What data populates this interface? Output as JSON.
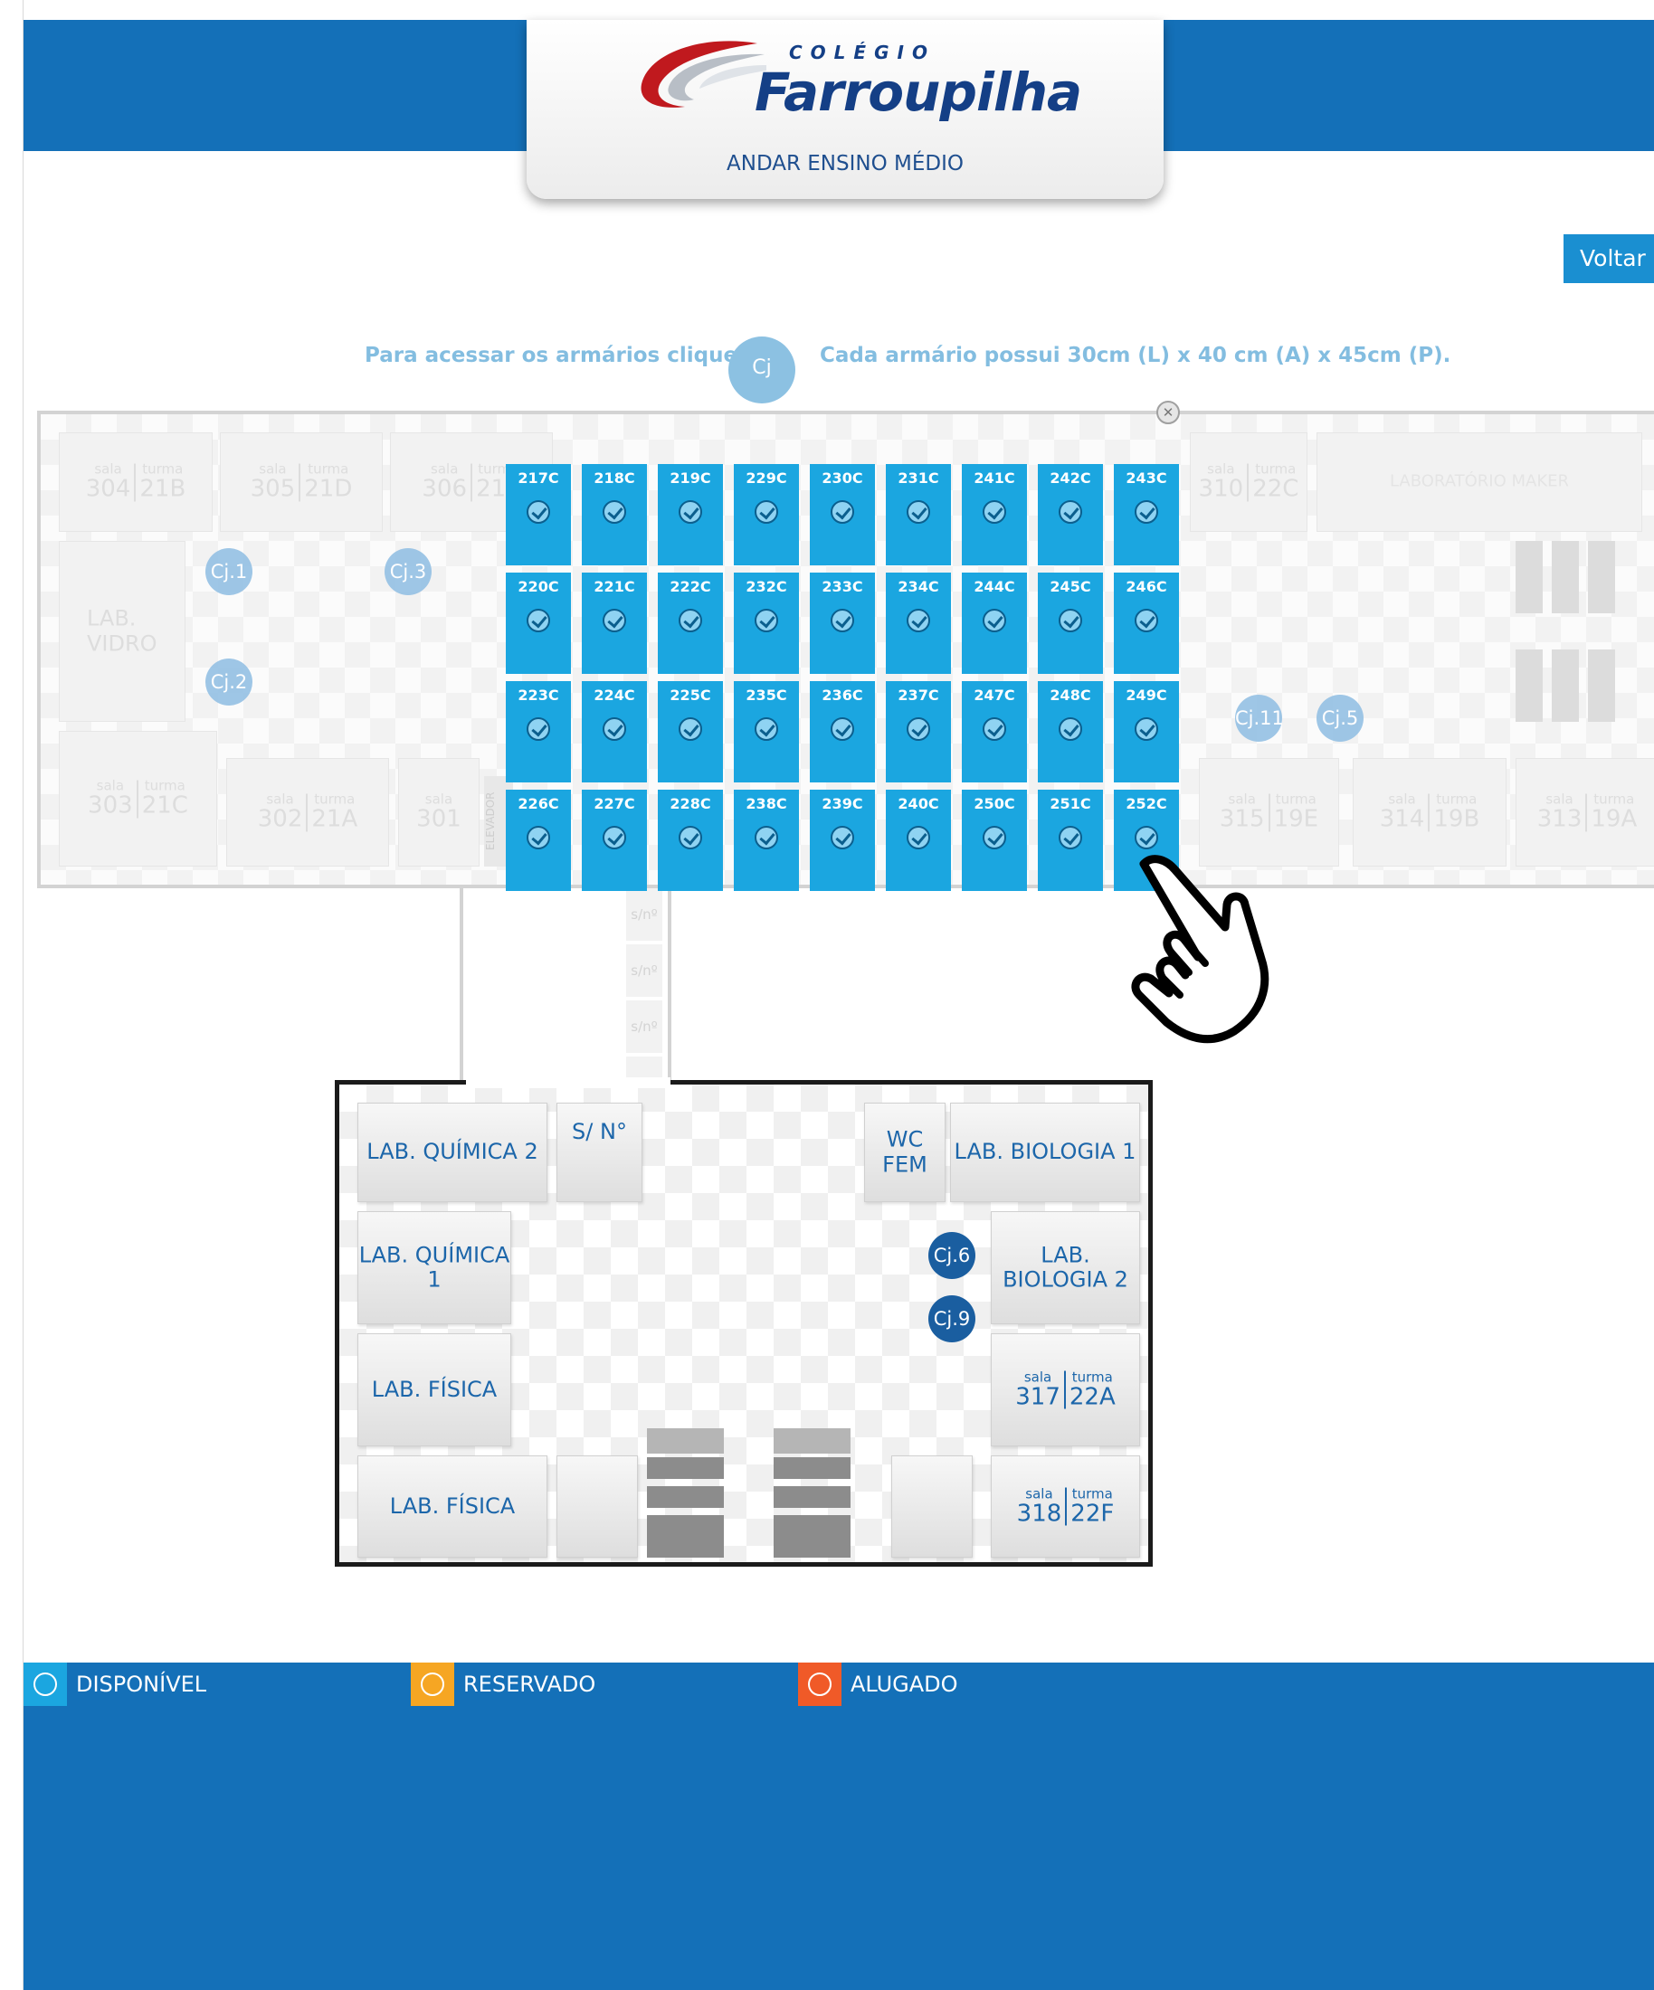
{
  "header": {
    "logo_small": "COLÉGIO",
    "logo_name": "Farroupilha",
    "floor_title": "ANDAR ENSINO MÉDIO",
    "back_label": "Voltar"
  },
  "instructions": {
    "left_text": "Para acessar os armários clique em",
    "badge": "Cj",
    "right_text": "Cada armário possui 30cm (L) x 40 cm (A) x 45cm (P)."
  },
  "upper_floor": {
    "room_304": {
      "w1": "sala",
      "w2": "turma",
      "room": "304",
      "class": "21B"
    },
    "room_305": {
      "w1": "sala",
      "w2": "turma",
      "room": "305",
      "class": "21D"
    },
    "room_306": {
      "w1": "sala",
      "w2": "turma",
      "room": "306",
      "class": "21E"
    },
    "room_310": {
      "w1": "sala",
      "w2": "turma",
      "room": "310",
      "class": "22C"
    },
    "lab_maker": "LABORATÓRIO MAKER",
    "lab_vidro": "LAB. VIDRO",
    "room_303": {
      "w1": "sala",
      "w2": "turma",
      "room": "303",
      "class": "21C"
    },
    "room_302": {
      "w1": "sala",
      "w2": "turma",
      "room": "302",
      "class": "21A"
    },
    "room_301": {
      "w1": "sala",
      "room": "301"
    },
    "elevator": "ELEVADOR",
    "room_315": {
      "w1": "sala",
      "w2": "turma",
      "room": "315",
      "class": "19E"
    },
    "room_314": {
      "w1": "sala",
      "w2": "turma",
      "room": "314",
      "class": "19B"
    },
    "room_313": {
      "w1": "sala",
      "w2": "turma",
      "room": "313",
      "class": "19A"
    },
    "cj1": "Cj.1",
    "cj2": "Cj.2",
    "cj3": "Cj.3",
    "cj11": "Cj.11",
    "cj5": "Cj.5"
  },
  "corridor": {
    "sn1": "s/nº",
    "sn2": "s/nº",
    "sn3": "s/nº",
    "sn4": "s/nº"
  },
  "lower_floor": {
    "lab_quimica_2": "LAB. QUÍMICA 2",
    "sn": "S/ N°",
    "wc_fem": "WC FEM",
    "lab_biologia_1": "LAB. BIOLOGIA 1",
    "lab_quimica_1": "LAB. QUÍMICA 1",
    "lab_biologia_2": "LAB. BIOLOGIA 2",
    "lab_fisica_a": "LAB. FÍSICA",
    "lab_fisica_b": "LAB. FÍSICA",
    "room_317": {
      "w1": "sala",
      "w2": "turma",
      "room": "317",
      "class": "22A"
    },
    "room_318": {
      "w1": "sala",
      "w2": "turma",
      "room": "318",
      "class": "22F"
    },
    "cj6": "Cj.6",
    "cj9": "Cj.9"
  },
  "lockers": {
    "status": "disponivel",
    "rows": [
      [
        "217C",
        "218C",
        "219C",
        "229C",
        "230C",
        "231C",
        "241C",
        "242C",
        "243C"
      ],
      [
        "220C",
        "221C",
        "222C",
        "232C",
        "233C",
        "234C",
        "244C",
        "245C",
        "246C"
      ],
      [
        "223C",
        "224C",
        "225C",
        "235C",
        "236C",
        "237C",
        "247C",
        "248C",
        "249C"
      ],
      [
        "226C",
        "227C",
        "228C",
        "238C",
        "239C",
        "240C",
        "250C",
        "251C",
        "252C"
      ]
    ]
  },
  "legend": {
    "available": {
      "label": "DISPONÍVEL",
      "color": "#1ba6e0"
    },
    "reserved": {
      "label": "RESERVADO",
      "color": "#f6a623"
    },
    "rented": {
      "label": "ALUGADO",
      "color": "#f05a28"
    }
  },
  "colors": {
    "brand_blue": "#1470b8",
    "locker_blue": "#1ba6e0",
    "navy": "#143f86"
  }
}
